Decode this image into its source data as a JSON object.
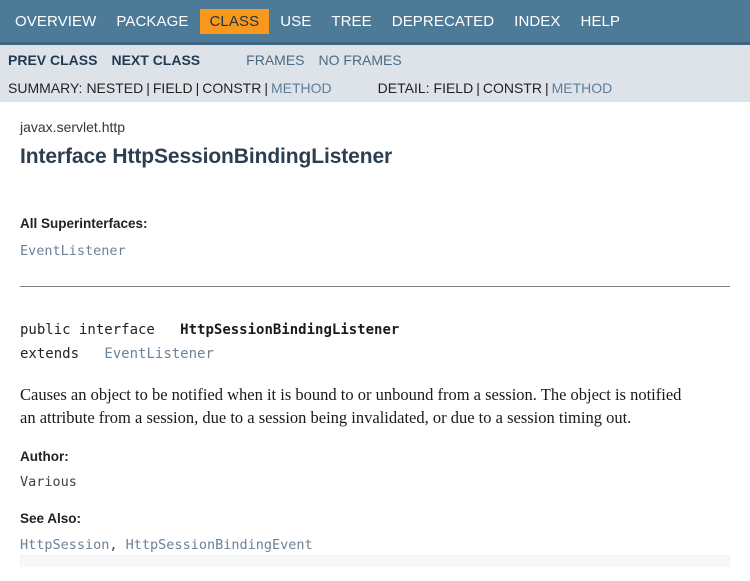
{
  "topnav": {
    "items": [
      {
        "label": "OVERVIEW",
        "active": false
      },
      {
        "label": "PACKAGE",
        "active": false
      },
      {
        "label": "CLASS",
        "active": true
      },
      {
        "label": "USE",
        "active": false
      },
      {
        "label": "TREE",
        "active": false
      },
      {
        "label": "DEPRECATED",
        "active": false
      },
      {
        "label": "INDEX",
        "active": false
      },
      {
        "label": "HELP",
        "active": false
      }
    ],
    "background_color": "#4d7a97",
    "active_color": "#f8981d"
  },
  "subnav": {
    "prev_class": "PREV CLASS",
    "next_class": "NEXT CLASS",
    "frames": "FRAMES",
    "no_frames": "NO FRAMES",
    "summary_label": "SUMMARY:",
    "summary_nested": "NESTED",
    "summary_field": "FIELD",
    "summary_constr": "CONSTR",
    "summary_method": "METHOD",
    "detail_label": "DETAIL:",
    "detail_field": "FIELD",
    "detail_constr": "CONSTR",
    "detail_method": "METHOD",
    "separator": "|"
  },
  "header": {
    "package": "javax.servlet.http",
    "title": "Interface HttpSessionBindingListener"
  },
  "superinterfaces": {
    "label": "All Superinterfaces:",
    "value": "EventListener"
  },
  "signature": {
    "modifiers": "public interface",
    "type_name": "HttpSessionBindingListener",
    "extends_keyword": "extends",
    "extends_type": "EventListener"
  },
  "description": {
    "line1": "Causes an object to be notified when it is bound to or unbound from a session. The object is notified",
    "line2": "an attribute from a session, due to a session being invalidated, or due to a session timing out."
  },
  "author": {
    "label": "Author:",
    "value": "Various"
  },
  "see_also": {
    "label": "See Also:",
    "link1": "HttpSession",
    "comma": ", ",
    "link2": "HttpSessionBindingEvent"
  }
}
